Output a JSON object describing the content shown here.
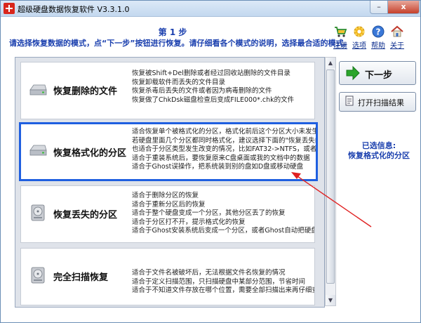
{
  "window": {
    "title": "超级硬盘数据恢复软件 V3.3.1.0",
    "minimize": "–",
    "close": "x"
  },
  "header": {
    "step_title": "第 1 步",
    "description": "请选择恢复数据的模式，点“下一步”按钮进行恢复。请仔细看各个模式的说明，选择最合适的模式。"
  },
  "toolbar": [
    {
      "label": "注册",
      "icon": "cart-icon"
    },
    {
      "label": "选项",
      "icon": "gear-icon"
    },
    {
      "label": "帮助",
      "icon": "help-icon"
    },
    {
      "label": "关于",
      "icon": "house-icon"
    }
  ],
  "options": [
    {
      "title": "恢复删除的文件",
      "icon": "drive-icon",
      "lines": [
        "恢复被Shift+Del删除或者经过回收站删除的文件目录",
        "恢复卸载软件而丢失的文件目录",
        "恢复杀毒后丢失的文件或者因为病毒删除的文件",
        "恢复做了ChkDsk磁盘检查后变成FILE000*.chk的文件"
      ]
    },
    {
      "title": "恢复格式化的分区",
      "icon": "drive-icon",
      "lines": [
        "适合恢复单个被格式化的分区，格式化前后这个分区大小未发生",
        "若硬盘里面几个分区都同时格式化，建议选择下面的\"恢复丢失的",
        "也适合于分区类型发生改变的情况，比如FAT32->NTFS，或者NT",
        "适合于重装系统后，要恢复原来C盘桌面或我的文档中的数据",
        "适合于Ghost误操作，把系统装到别的盘如D盘或移动硬盘"
      ]
    },
    {
      "title": "恢复丢失的分区",
      "icon": "drive-icon",
      "lines": [
        "适合于删除分区的恢复",
        "适合于重新分区后的恢复",
        "适合于整个硬盘变成一个分区，其他分区丢了的恢复",
        "适合于分区打不开，提示格式化的恢复",
        "适合于Ghost安装系统后变成一个分区，或者Ghost自动把硬盘分"
      ]
    },
    {
      "title": "完全扫描恢复",
      "icon": "drive-icon",
      "lines": [
        "适合于文件名被破坏后，无法根据文件名恢复的情况",
        "适合于定义扫描范围，只扫描硬盘中某部分范围，节省时间",
        "适合于不知道文件存放在哪个位置，需要全部扫描出来再仔细查"
      ]
    }
  ],
  "buttons": {
    "next": "下一步",
    "open_scan": "打开扫描结果"
  },
  "selected_info": {
    "label": "已选信息:",
    "value": "恢复格式化的分区"
  },
  "colors": {
    "accent_blue": "#1a3fae",
    "selection_border": "#1f5fe0",
    "annotation_red": "#e02020",
    "next_arrow_green": "#2aa52a"
  }
}
